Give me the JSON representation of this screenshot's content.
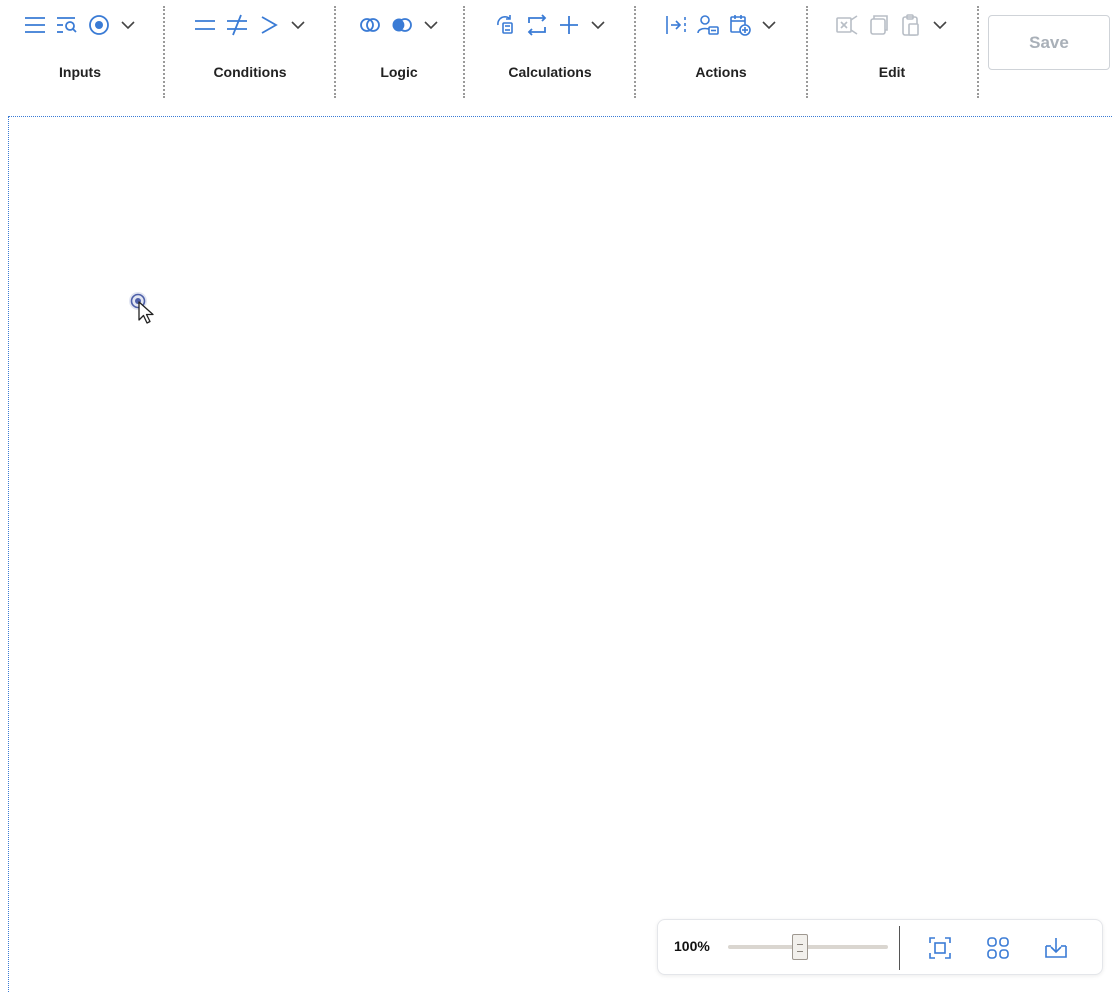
{
  "toolbar": {
    "groups": [
      {
        "label": "Inputs",
        "icons": [
          "menu-lines-icon",
          "search-list-icon",
          "radio-target-icon",
          "chevron-down-icon"
        ]
      },
      {
        "label": "Conditions",
        "icons": [
          "equals-icon",
          "not-equals-icon",
          "greater-than-icon",
          "chevron-down-icon"
        ]
      },
      {
        "label": "Logic",
        "icons": [
          "intersect-circles-icon",
          "overlap-circles-icon",
          "chevron-down-icon"
        ]
      },
      {
        "label": "Calculations",
        "icons": [
          "refresh-calc-icon",
          "loop-arrows-icon",
          "plus-icon",
          "chevron-down-icon"
        ]
      },
      {
        "label": "Actions",
        "icons": [
          "step-into-icon",
          "assign-user-icon",
          "calendar-add-icon",
          "chevron-down-icon"
        ]
      },
      {
        "label": "Edit",
        "icons": [
          "cut-icon",
          "copy-icon",
          "paste-icon",
          "chevron-down-icon"
        ]
      }
    ],
    "save_label": "Save"
  },
  "zoom": {
    "value_label": "100%",
    "level_percent": 100,
    "icons": [
      "fit-to-screen-icon",
      "grid-view-icon",
      "download-icon"
    ]
  },
  "colors": {
    "accent": "#3a7bd5",
    "disabled": "#b8bec6",
    "label": "#222222"
  }
}
